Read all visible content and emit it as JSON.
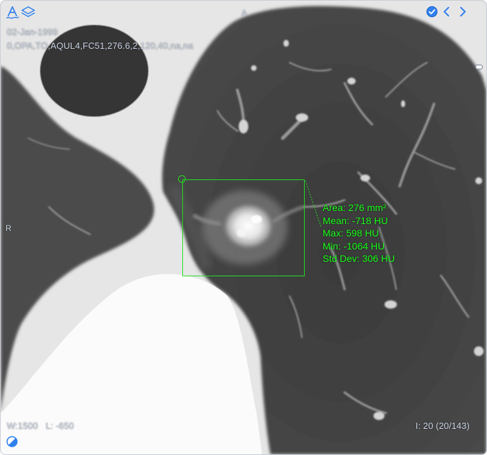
{
  "orientation": {
    "top": "A",
    "left": "R"
  },
  "study": {
    "date": "02-Jan-1999",
    "params": "0,OPA,TO,AQUL4,FC51,276.6,2,120,40,na,na"
  },
  "window_level": {
    "width_label": "W:",
    "width_value": "1500",
    "level_label": "L:",
    "level_value": "-650"
  },
  "image_index": {
    "label": "I:",
    "value": "20 (20/143)"
  },
  "roi_stats": {
    "area": "Area: 276 mm²",
    "mean": "Mean: -718 HU",
    "max": "Max: 598 HU",
    "min": "Min: -1064 HU",
    "std_dev": "Std Dev: 306 HU"
  },
  "toolbar": {
    "left_icons": [
      "annotation-tool-icon",
      "layers-icon"
    ],
    "right_icons": [
      "check-circle-icon",
      "chevron-left-icon",
      "chevron-right-icon"
    ]
  },
  "colors": {
    "accent": "#2f80ed",
    "roi": "#22dd22",
    "roi_text": "#19ff19",
    "overlay_text": "#c9d3e3"
  }
}
